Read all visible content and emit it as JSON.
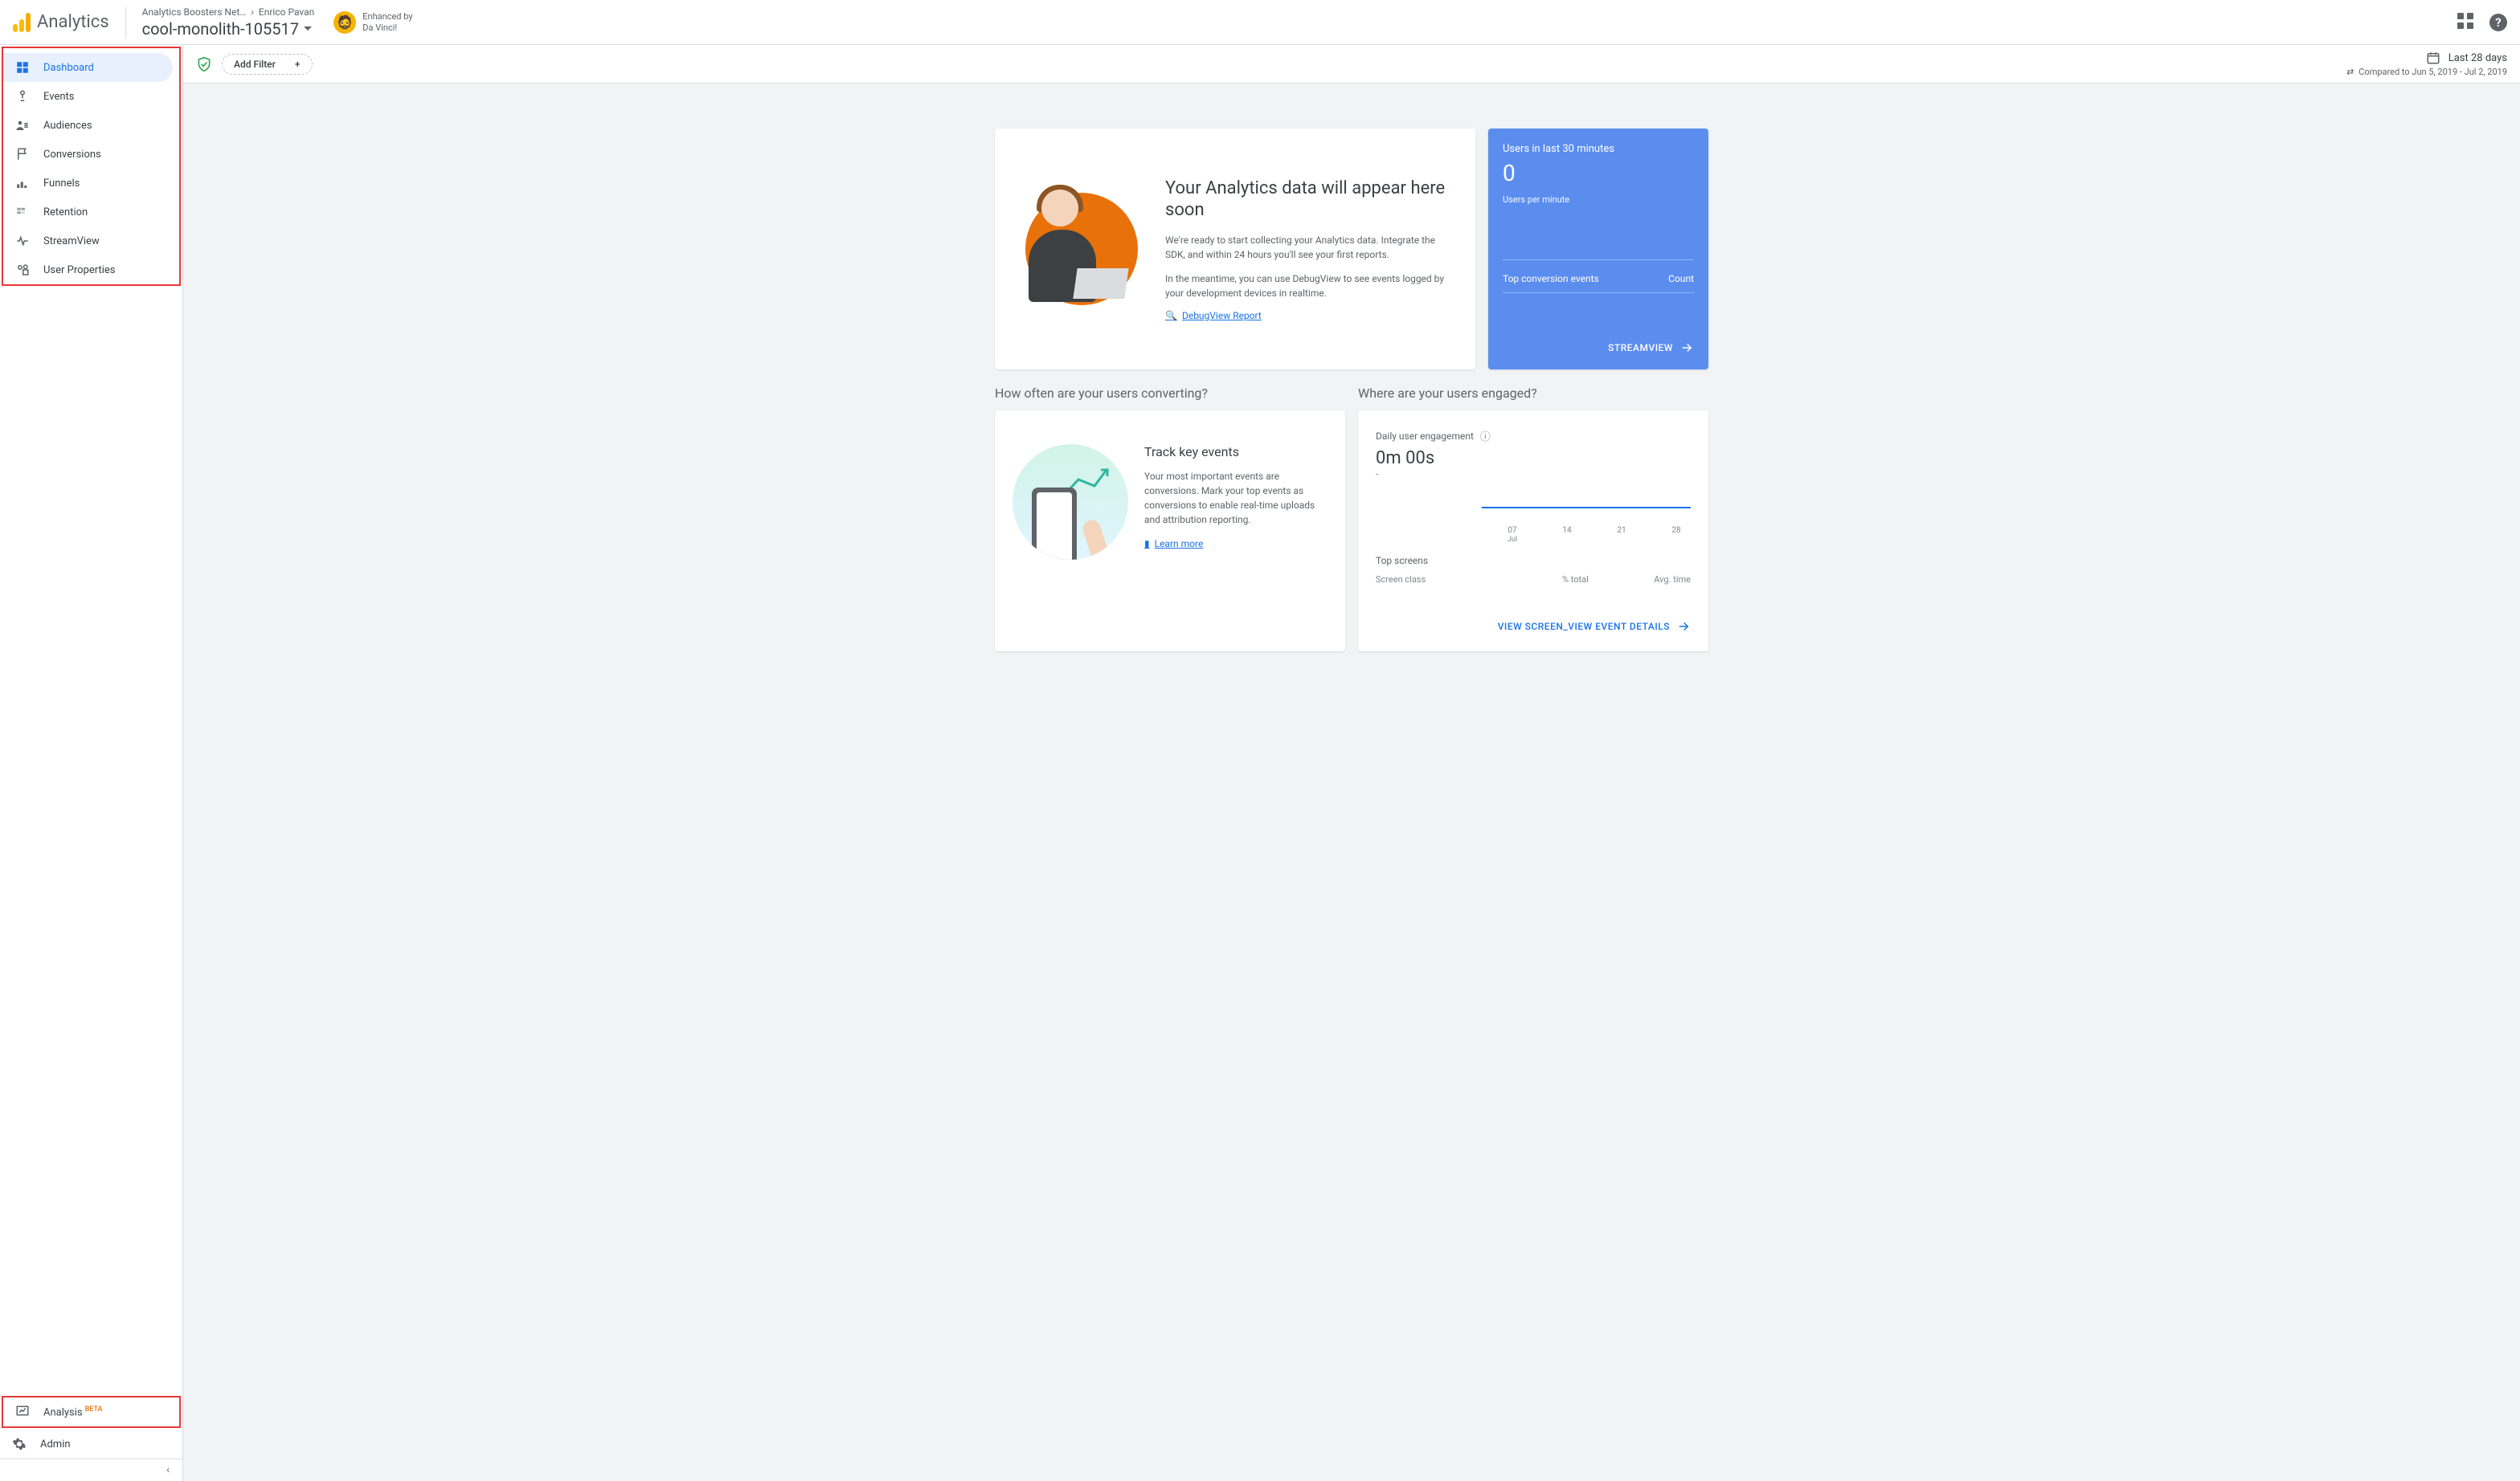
{
  "header": {
    "app_title": "Analytics",
    "breadcrumb": {
      "account": "Analytics Boosters Net…",
      "user": "Enrico Pavan",
      "property": "cool-monolith-105517"
    },
    "davinci": {
      "line1": "Enhanced by",
      "line2": "Da Vinci!"
    }
  },
  "sidebar": {
    "items": [
      {
        "id": "dashboard",
        "label": "Dashboard"
      },
      {
        "id": "events",
        "label": "Events"
      },
      {
        "id": "audiences",
        "label": "Audiences"
      },
      {
        "id": "conversions",
        "label": "Conversions"
      },
      {
        "id": "funnels",
        "label": "Funnels"
      },
      {
        "id": "retention",
        "label": "Retention"
      },
      {
        "id": "streamview",
        "label": "StreamView"
      },
      {
        "id": "user-properties",
        "label": "User Properties"
      }
    ],
    "analysis": {
      "label": "Analysis",
      "badge": "BETA"
    },
    "admin": {
      "label": "Admin"
    }
  },
  "toolbar": {
    "add_filter": "Add Filter",
    "date_range": "Last 28 days",
    "compared": "Compared to Jun 5, 2019 - Jul 2, 2019"
  },
  "welcome": {
    "title": "Your Analytics data will appear here soon",
    "p1": "We're ready to start collecting your Analytics data. Integrate the SDK, and within 24 hours you'll see your first reports.",
    "p2": "In the meantime, you can use DebugView to see events logged by your development devices in realtime.",
    "link": "DebugView Report"
  },
  "realtime": {
    "title": "Users in last 30 minutes",
    "count": "0",
    "per_min": "Users per minute",
    "events_label": "Top conversion events",
    "count_label": "Count",
    "link": "STREAMVIEW"
  },
  "sections": {
    "convert": "How often are your users converting?",
    "engage": "Where are your users engaged?"
  },
  "track": {
    "title": "Track key events",
    "body": "Your most important events are conversions. Mark your top events as conversions to enable real-time uploads and attribution reporting.",
    "link": "Learn more"
  },
  "engage": {
    "title": "Daily user engagement",
    "value": "0m 00s",
    "dash": "-",
    "xticks": [
      "07",
      "14",
      "21",
      "28"
    ],
    "xsub": "Jul",
    "topscreens": "Top screens",
    "col1": "Screen class",
    "col2": "% total",
    "col3": "Avg. time",
    "link": "VIEW SCREEN_VIEW EVENT DETAILS"
  },
  "chart_data": {
    "type": "line",
    "title": "Daily user engagement",
    "x": [
      "07",
      "14",
      "21",
      "28"
    ],
    "values": [
      0,
      0,
      0,
      0
    ],
    "xlabel": "Jul",
    "ylabel": "",
    "ylim": [
      0,
      1
    ]
  }
}
